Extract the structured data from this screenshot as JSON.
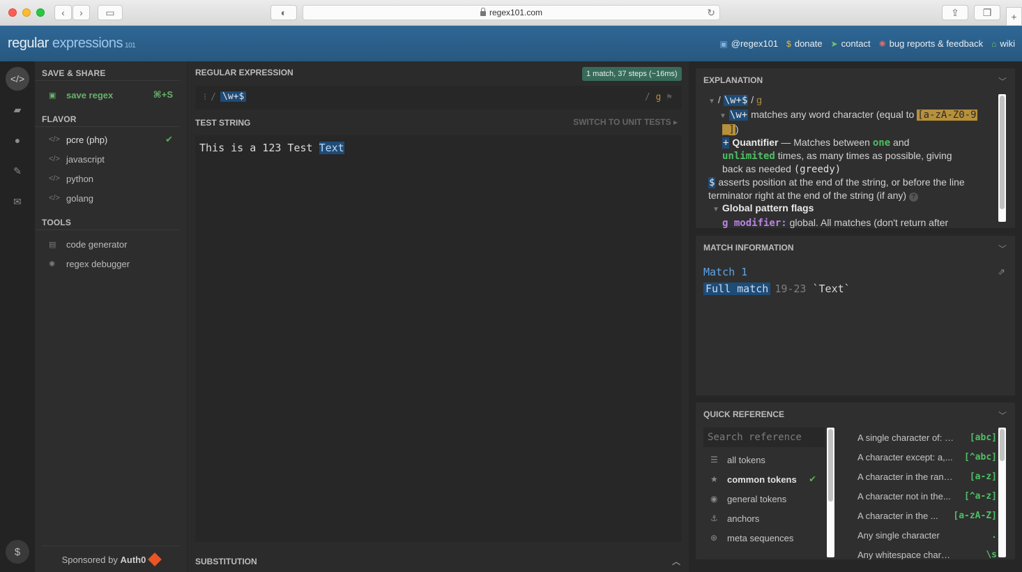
{
  "browser": {
    "url": "regex101.com"
  },
  "header": {
    "logo_a": "regular",
    "logo_b": " expressions",
    "logo_c": "101",
    "links": [
      {
        "icon": "twitter-icon",
        "label": "@regex101"
      },
      {
        "icon": "dollar-icon",
        "label": "donate"
      },
      {
        "icon": "paper-plane-icon",
        "label": "contact"
      },
      {
        "icon": "bug-icon",
        "label": "bug reports & feedback"
      },
      {
        "icon": "library-icon",
        "label": "wiki"
      }
    ]
  },
  "side": {
    "save_share": "SAVE & SHARE",
    "save_label": "save regex",
    "save_shortcut": "⌘+S",
    "flavor": "FLAVOR",
    "flavors": [
      "pcre (php)",
      "javascript",
      "python",
      "golang"
    ],
    "tools": "TOOLS",
    "tool_items": [
      "code generator",
      "regex debugger"
    ],
    "sponsor_text": "Sponsored by",
    "sponsor_name": "Auth0"
  },
  "editor": {
    "regex_heading": "REGULAR EXPRESSION",
    "status_badge": "1 match, 37 steps (~16ms)",
    "delimiter": "/",
    "pattern": "\\w+$",
    "flag_delim": "/",
    "flags": "g",
    "test_heading": "TEST STRING",
    "switch_label": "SWITCH TO UNIT TESTS",
    "test_before": "This is a 123 Test ",
    "test_match": "Text",
    "substitution_heading": "SUBSTITUTION"
  },
  "explanation": {
    "heading": "EXPLANATION",
    "root_delim": "/",
    "root_pattern": "\\w+$",
    "root_flags": "g",
    "w_token": "\\w+",
    "w_text": " matches any word character (equal to ",
    "w_set_1": "[a-zA-Z0-9",
    "w_set_2": "_]",
    "w_close": ")",
    "plus_token": "+",
    "quant_label": "Quantifier",
    "quant_text_1": " — Matches between ",
    "one": "one",
    "and": " and",
    "unlimited": "unlimited",
    "quant_text_2": " times, as many times as possible, giving",
    "quant_text_3": "back as needed ",
    "greedy": "(greedy)",
    "dollar_token": "$",
    "dollar_text_1": " asserts position at the end of the string, or before the line",
    "dollar_text_2": "terminator right at the end of the string (if any)",
    "help_mark": "?",
    "global_label": "Global pattern flags",
    "g_mod": "g modifier:",
    "g_text": " global. All matches (don't return after"
  },
  "match_info": {
    "heading": "MATCH INFORMATION",
    "match_label": "Match 1",
    "full_match_label": "Full match",
    "range": "19-23",
    "value": "`Text`"
  },
  "quick_ref": {
    "heading": "QUICK REFERENCE",
    "search_placeholder": "Search reference",
    "categories": [
      {
        "icon": "database-icon",
        "label": "all tokens"
      },
      {
        "icon": "star-icon",
        "label": "common tokens",
        "selected": true
      },
      {
        "icon": "circle-dot-icon",
        "label": "general tokens"
      },
      {
        "icon": "anchor-icon",
        "label": "anchors"
      },
      {
        "icon": "globe-icon",
        "label": "meta sequences"
      }
    ],
    "tokens": [
      {
        "desc": "A single character of: a...",
        "token": "[abc]"
      },
      {
        "desc": "A character except: a,...",
        "token": "[^abc]"
      },
      {
        "desc": "A character in the rang...",
        "token": "[a-z]"
      },
      {
        "desc": "A character not in the...",
        "token": "[^a-z]"
      },
      {
        "desc": "A character in the ...",
        "token": "[a-zA-Z]"
      },
      {
        "desc": "Any single character",
        "token": "."
      },
      {
        "desc": "Any whitespace character",
        "token": "\\s"
      }
    ]
  },
  "colors": {
    "header_blue": "#2a5f8e",
    "match_green": "#4fbf64",
    "match_blue": "#1f4b77"
  }
}
